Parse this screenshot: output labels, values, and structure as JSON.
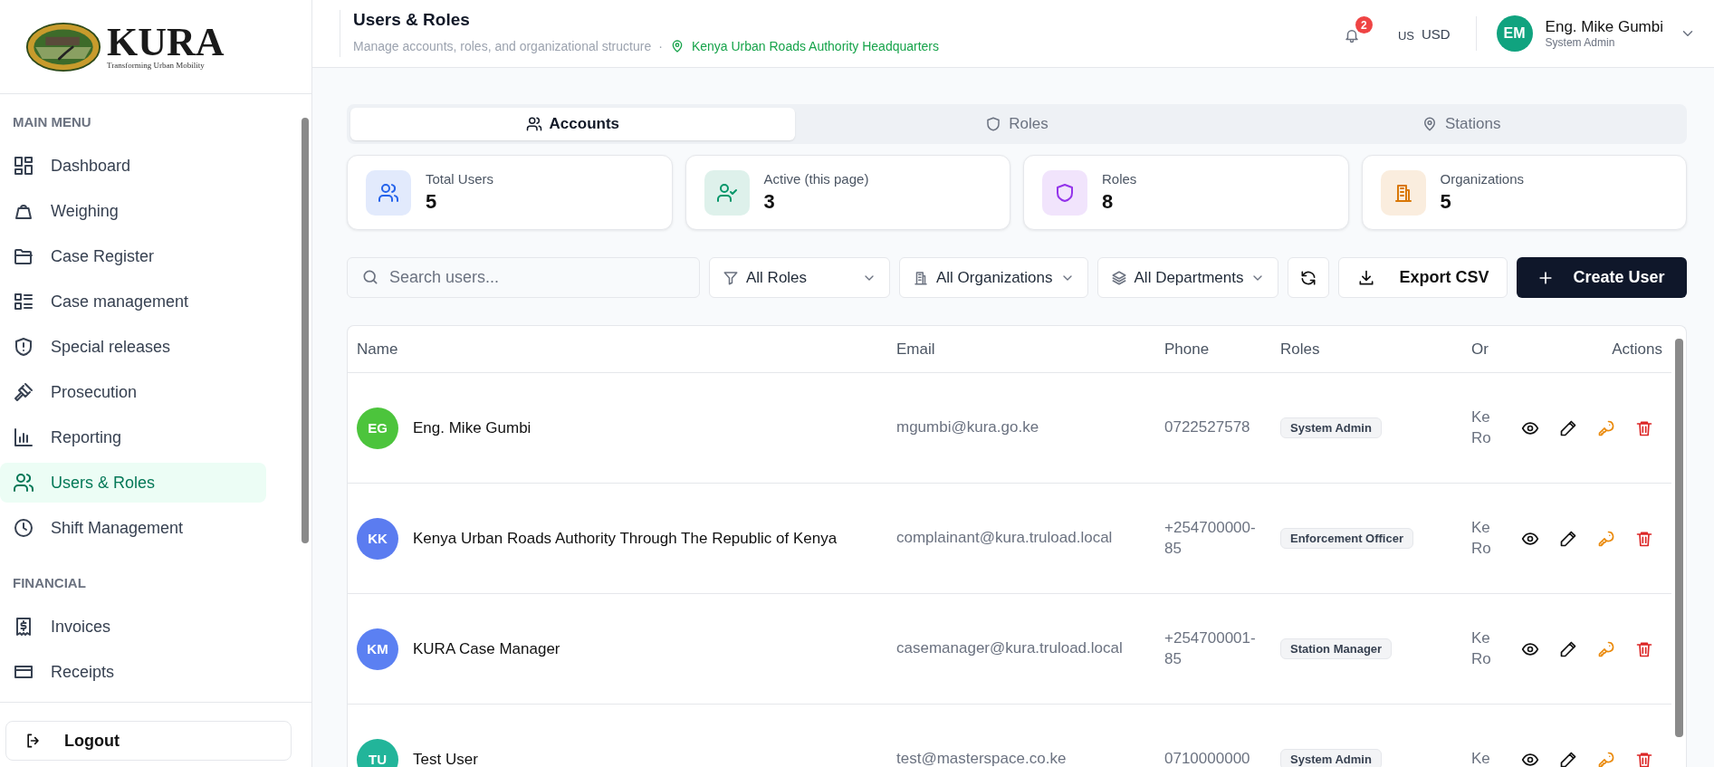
{
  "sidebar": {
    "logo": {
      "name": "KURA",
      "tagline": "Transforming Urban Mobility"
    },
    "sections": [
      {
        "title": "MAIN MENU",
        "items": [
          {
            "label": "Dashboard",
            "selected": false
          },
          {
            "label": "Weighing",
            "selected": false
          },
          {
            "label": "Case Register",
            "selected": false
          },
          {
            "label": "Case management",
            "selected": false
          },
          {
            "label": "Special releases",
            "selected": false
          },
          {
            "label": "Prosecution",
            "selected": false
          },
          {
            "label": "Reporting",
            "selected": false
          },
          {
            "label": "Users & Roles",
            "selected": true
          },
          {
            "label": "Shift Management",
            "selected": false
          }
        ]
      },
      {
        "title": "FINANCIAL",
        "items": [
          {
            "label": "Invoices",
            "selected": false
          },
          {
            "label": "Receipts",
            "selected": false
          }
        ]
      }
    ],
    "logout": "Logout"
  },
  "header": {
    "title": "Users & Roles",
    "subtitle": "Manage accounts, roles, and organizational structure",
    "separator": "·",
    "location": "Kenya Urban Roads Authority Headquarters",
    "notifications": "2",
    "currency_region": "US",
    "currency": "USD",
    "user": {
      "initials": "EM",
      "name": "Eng. Mike Gumbi",
      "role": "System Admin"
    }
  },
  "tabs": [
    {
      "label": "Accounts",
      "selected": true
    },
    {
      "label": "Roles",
      "selected": false
    },
    {
      "label": "Stations",
      "selected": false
    }
  ],
  "stats": [
    {
      "label": "Total Users",
      "value": "5",
      "color": "#2563eb"
    },
    {
      "label": "Active (this page)",
      "value": "3",
      "color": "#059669"
    },
    {
      "label": "Roles",
      "value": "8",
      "color": "#9333ea"
    },
    {
      "label": "Organizations",
      "value": "5",
      "color": "#d97706"
    }
  ],
  "filters": {
    "search": {
      "placeholder": "Search users..."
    },
    "dropdowns": [
      "All Roles",
      "All Organizations",
      "All Departments"
    ],
    "export": "Export CSV",
    "create": "Create User"
  },
  "table": {
    "columns": [
      "Name",
      "Email",
      "Phone",
      "Roles",
      "Or",
      "Actions"
    ],
    "rows": [
      {
        "initials": "EG",
        "color": "#4cc43c",
        "name": "Eng. Mike Gumbi",
        "email": "mgumbi@kura.go.ke",
        "phone": "0722527578",
        "role": "System Admin",
        "org": "Ke\nRo"
      },
      {
        "initials": "KK",
        "color": "#5b7cf0",
        "name": "Kenya Urban Roads Authority Through The Republic of Kenya",
        "email": "complainant@kura.truload.local",
        "phone": "+254700000-85",
        "role": "Enforcement Officer",
        "org": "Ke\nRo"
      },
      {
        "initials": "KM",
        "color": "#5b80f2",
        "name": "KURA Case Manager",
        "email": "casemanager@kura.truload.local",
        "phone": "+254700001-85",
        "role": "Station Manager",
        "org": "Ke\nRo"
      },
      {
        "initials": "TU",
        "color": "#22b59a",
        "name": "Test User",
        "email": "test@masterspace.co.ke",
        "phone": "0710000000",
        "role": "System Admin",
        "org": "Ke"
      }
    ]
  }
}
